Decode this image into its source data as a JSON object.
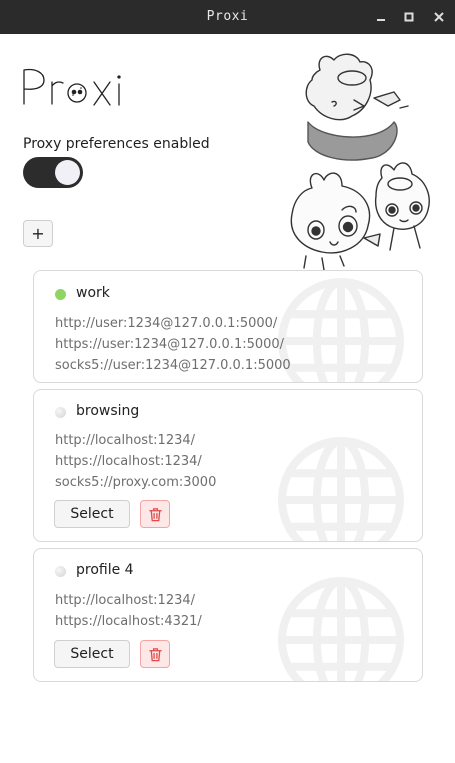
{
  "window": {
    "title": "Proxi",
    "controls": {
      "minimize_icon": "minimize-icon",
      "maximize_icon": "maximize-icon",
      "close_icon": "close-icon"
    }
  },
  "app": {
    "logo_text": "Proxi",
    "mascot_icon": "bunny-mascot-illustration"
  },
  "preferences": {
    "label": "Proxy preferences enabled",
    "enabled": true
  },
  "add_button": {
    "label": "+"
  },
  "profiles": [
    {
      "name": "work",
      "active": true,
      "urls": [
        "http://user:1234@127.0.0.1:5000/",
        "https://user:1234@127.0.0.1:5000/",
        "socks5://user:1234@127.0.0.1:5000"
      ]
    },
    {
      "name": "browsing",
      "active": false,
      "urls": [
        "http://localhost:1234/",
        "https://localhost:1234/",
        "socks5://proxy.com:3000"
      ],
      "select_label": "Select"
    },
    {
      "name": "profile 4",
      "active": false,
      "urls": [
        "http://localhost:1234/",
        "https://localhost:4321/"
      ],
      "select_label": "Select"
    }
  ],
  "colors": {
    "titlebar": "#2b2b2b",
    "active_dot": "#8ed661",
    "toggle_on": "#2c2c2c",
    "delete_bg": "#fde7e7",
    "delete_border": "#f3a5a5",
    "delete_icon": "#e04b4b"
  }
}
